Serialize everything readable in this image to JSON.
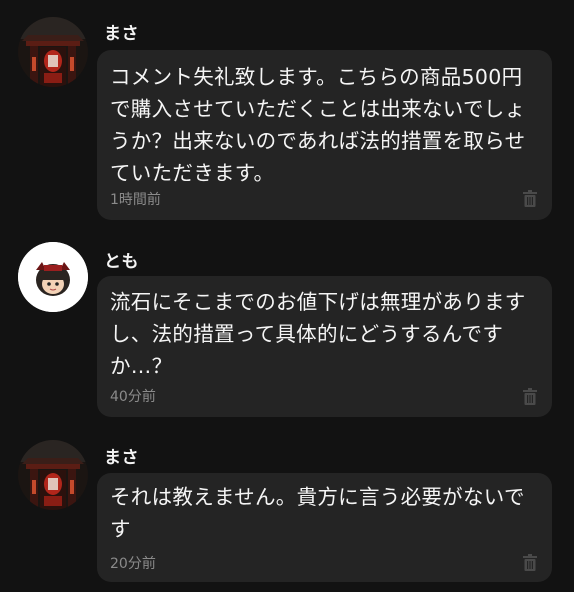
{
  "comments": [
    {
      "username": "まさ",
      "text": "コメント失礼致します。こちらの商品500円で購入させていただくことは出来ないでしょうか？出来ないのであれば法的措置を取らせていただきます。",
      "time": "1時間前",
      "avatar": "gate-photo-avatar",
      "action_icon": "trash-icon"
    },
    {
      "username": "とも",
      "text": "流石にそこまでのお値下げは無理がありますし、法的措置って具体的にどうするんですか…？",
      "time": "40分前",
      "avatar": "character-avatar",
      "action_icon": "trash-icon"
    },
    {
      "username": "まさ",
      "text": "それは教えません。貴方に言う必要がないです",
      "time": "20分前",
      "avatar": "gate-photo-avatar",
      "action_icon": "trash-icon"
    }
  ],
  "colors": {
    "background": "#121212",
    "bubble": "#242424",
    "text": "#f5f5f5",
    "timestamp": "#8a8a8a",
    "icon": "#4a4a4a"
  }
}
